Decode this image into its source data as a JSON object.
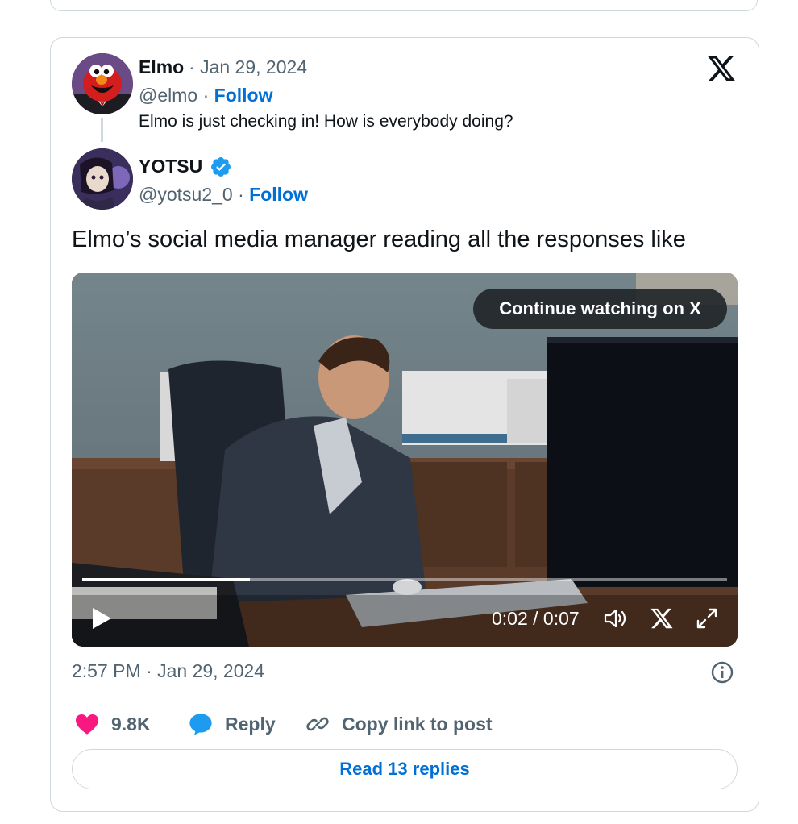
{
  "colors": {
    "link": "#006fd6",
    "text_primary": "#0f1419",
    "text_secondary": "#536471",
    "like": "#f91880",
    "reply": "#1d9bf0",
    "border": "#cfd9de"
  },
  "quoted_post": {
    "author_name": "Elmo",
    "date": "Jan 29, 2024",
    "handle": "@elmo",
    "follow_label": "Follow",
    "text": "Elmo is just checking in! How is everybody doing?",
    "avatar_icon": "elmo-avatar"
  },
  "post": {
    "author_name": "YOTSU",
    "verified_icon": "verified-badge-icon",
    "handle": "@yotsu2_0",
    "follow_label": "Follow",
    "text": "Elmo’s social media manager reading all the responses like",
    "avatar_icon": "anime-avatar",
    "timestamp": "2:57 PM · Jan 29, 2024"
  },
  "video": {
    "continue_label": "Continue watching on X",
    "time_text": "0:02 / 0:07",
    "progress": 0.26,
    "icons": [
      "play-icon",
      "volume-icon",
      "x-logo-icon",
      "fullscreen-icon"
    ]
  },
  "actions": {
    "likes": "9.8K",
    "reply_label": "Reply",
    "copy_label": "Copy link to post"
  },
  "read_replies_label": "Read 13 replies"
}
